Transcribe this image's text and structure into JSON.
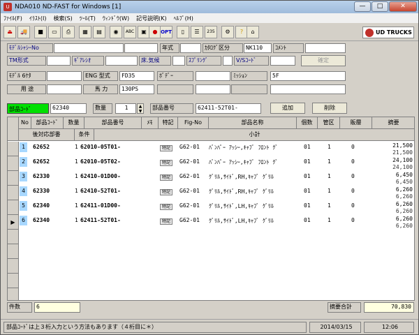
{
  "window": {
    "title": "NDA010 ND-FAST for Windows [1]",
    "minimize": "—",
    "maximize": "□",
    "close": "✕"
  },
  "menu": [
    "ﾌｧｲﾙ(F)",
    "ｲﾗｽﾄ(I)",
    "検索(S)",
    "ﾂｰﾙ(T)",
    "ｳｨﾝﾄﾞｳ(W)",
    "記号説明(K)",
    "ﾍﾙﾌﾟ(H)"
  ],
  "toolbar": {
    "icons": [
      "exit-icon",
      "car-icon",
      "save-icon",
      "folder-icon",
      "print-icon",
      "table-icon",
      "grid-icon",
      "globe-icon",
      "abc-icon",
      "image-icon",
      "target-icon",
      "opt-icon",
      "book-icon",
      "list-icon",
      "number-icon",
      "gear-icon",
      "bulb-icon",
      "home-icon"
    ],
    "opt_label": "OPT",
    "ud_label": "UD TRUCKS"
  },
  "form": {
    "model_chassis_label": "ﾓﾃﾞﾙｼｬｼｰNo",
    "year_label": "年式",
    "catalog_label": "ｶﾀﾛｸﾞ区分",
    "catalog_value": "NK110",
    "comment_label": "ｺﾒﾝﾄ",
    "tm_label": "TM形式",
    "gear_ratio_label": "ｷﾞｱﾚｼｵ",
    "floor_label": "床.気候",
    "spring_label": "ｽﾌﾟﾘﾝｸﾞ",
    "vs_code_label": "V/Sｺｰﾄﾞ",
    "confirm_button": "確定",
    "model6_label": "ﾓﾃﾞﾙ 6ｹﾀ",
    "eng_label": "ENG 型式",
    "eng_value": "FD35",
    "body_label": "ﾎﾞﾃﾞｰ",
    "mission_label": "ﾐｯｼｮﾝ",
    "mission_value": "5F",
    "use_label": "用 途",
    "horsepower_label": "馬 力",
    "horsepower_value": "130PS"
  },
  "search": {
    "part_code_label": "部品ｺｰﾄﾞ",
    "part_code_value": "62340",
    "qty_label": "数量",
    "qty_value": "1",
    "part_no_label": "部品番号",
    "part_no_value": "62411-52T01-",
    "add_button": "追加",
    "delete_button": "削除"
  },
  "table": {
    "headers": [
      "No",
      "部品ｺｰﾄﾞ",
      "数量",
      "部品番号",
      "ﾒﾓ",
      "特記",
      "Fig-No",
      "部品名称",
      "個数",
      "管区",
      "販層",
      "摘要"
    ],
    "subheaders": [
      "後対応部番",
      "条件",
      "小計"
    ],
    "rows": [
      {
        "no": "1",
        "code": "62652",
        "qty": "1",
        "partno": "62010-05T01-",
        "badge": "特記",
        "fig": "G62-01",
        "name": "ﾊﾞﾝﾊﾟｰ ｱｯｼｰ,ｷｬﾌﾞ ﾌﾛﾝﾄ ｸﾞ",
        "count": "01",
        "kanku": "1",
        "hanso": "0",
        "price": "21,500",
        "subtotal": "21,500"
      },
      {
        "no": "2",
        "code": "62652",
        "qty": "1",
        "partno": "62010-05T02-",
        "badge": "特記",
        "fig": "G62-01",
        "name": "ﾊﾞﾝﾊﾟｰ ｱｯｼｰ,ｷｬﾌﾞ ﾌﾛﾝﾄ ｸﾞ",
        "count": "01",
        "kanku": "1",
        "hanso": "0",
        "price": "24,100",
        "subtotal": "24,100"
      },
      {
        "no": "3",
        "code": "62330",
        "qty": "1",
        "partno": "62410-01D00-",
        "badge": "特記",
        "fig": "G62-01",
        "name": "ｸﾞﾘﾙ,ｻｲﾄﾞ,RH,ｷｬﾌﾞ ｸﾞﾘﾙ",
        "count": "01",
        "kanku": "1",
        "hanso": "0",
        "price": "6,450",
        "subtotal": "6,450"
      },
      {
        "no": "4",
        "code": "62330",
        "qty": "1",
        "partno": "62410-52T01-",
        "badge": "特記",
        "fig": "G62-01",
        "name": "ｸﾞﾘﾙ,ｻｲﾄﾞ,RH,ｷｬﾌﾞ ｸﾞﾘﾙ",
        "count": "01",
        "kanku": "1",
        "hanso": "0",
        "price": "6,260",
        "subtotal": "6,260"
      },
      {
        "no": "5",
        "code": "62340",
        "qty": "1",
        "partno": "62411-01D00-",
        "badge": "特記",
        "fig": "G62-01",
        "name": "ｸﾞﾘﾙ,ｻｲﾄﾞ,LH,ｷｬﾌﾞ ｸﾞﾘﾙ",
        "count": "01",
        "kanku": "1",
        "hanso": "0",
        "price": "6,260",
        "subtotal": "6,260"
      },
      {
        "no": "6",
        "code": "62340",
        "qty": "1",
        "partno": "62411-52T01-",
        "badge": "特記",
        "fig": "G62-01",
        "name": "ｸﾞﾘﾙ,ｻｲﾄﾞ,LH,ｷｬﾌﾞ ｸﾞﾘﾙ",
        "count": "01",
        "kanku": "1",
        "hanso": "0",
        "price": "6,260",
        "subtotal": "6,260"
      }
    ],
    "current_row_marker": "▶"
  },
  "footer": {
    "count_label": "件数",
    "count_value": "6",
    "total_label": "摘要合計",
    "total_value": "70,830"
  },
  "status": {
    "message": "部品ｺｰﾄﾞは上３桁入力という方法もあります（４桁目に＊）",
    "date": "2014/03/15",
    "time": "12:06"
  }
}
